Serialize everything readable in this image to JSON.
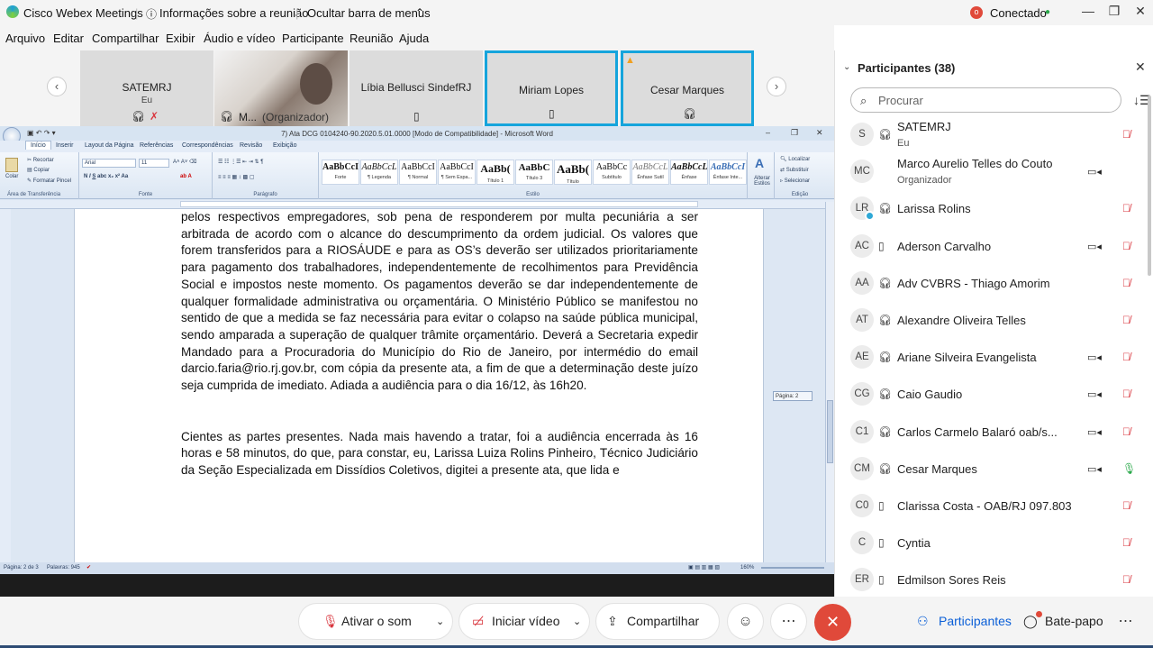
{
  "topbar": {
    "app_title": "Cisco Webex Meetings",
    "meeting_info": "Informações sobre a reunião",
    "hide_menu": "Ocultar barra de menus",
    "status_badge": "o",
    "status": "Conectado"
  },
  "menu": [
    "Arquivo",
    "Editar",
    "Compartilhar",
    "Exibir",
    "Áudio e vídeo",
    "Participante",
    "Reunião",
    "Ajuda"
  ],
  "video_tiles": [
    {
      "name": "SATEMRJ",
      "sub": "Eu"
    },
    {
      "name": "M...",
      "sub": "(Organizador)"
    },
    {
      "name": "Líbia Bellusci SindefRJ"
    },
    {
      "name": "Miriam Lopes"
    },
    {
      "name": "Cesar Marques"
    }
  ],
  "word": {
    "title": "7) Ata DCG 0104240-90.2020.5.01.0000 [Modo de Compatibilidade] - Microsoft Word",
    "tabs": [
      "Início",
      "Inserir",
      "Layout da Página",
      "Referências",
      "Correspondências",
      "Revisão",
      "Exibição"
    ],
    "clipboard": {
      "recortar": "Recortar",
      "copiar": "Copiar",
      "colar": "Colar",
      "pincel": "Formatar Pincel",
      "label": "Área de Transferência"
    },
    "font": {
      "name": "Arial",
      "size": "11",
      "label": "Fonte"
    },
    "paragraph_label": "Parágrafo",
    "styles_label": "Estilo",
    "styles": [
      {
        "sample": "AaBbCcI",
        "name": "Forte"
      },
      {
        "sample": "AaBbCcL",
        "name": "¶ Legenda"
      },
      {
        "sample": "AaBbCcI",
        "name": "¶ Normal"
      },
      {
        "sample": "AaBbCcI",
        "name": "¶ Sem Espa..."
      },
      {
        "sample": "AaBb(",
        "name": "Título 1"
      },
      {
        "sample": "AaBbC",
        "name": "Título 3"
      },
      {
        "sample": "AaBb(",
        "name": "Título"
      },
      {
        "sample": "AaBbCc",
        "name": "Subtítulo"
      },
      {
        "sample": "AaBbCcL",
        "name": "Ênfase Sutil"
      },
      {
        "sample": "AaBbCcL",
        "name": "Ênfase"
      },
      {
        "sample": "AaBbCcI",
        "name": "Ênfase Inte..."
      }
    ],
    "alterar_estilos": "Alterar Estilos",
    "editing": {
      "localizar": "Localizar",
      "substituir": "Substituir",
      "selecionar": "Selecionar",
      "label": "Edição"
    },
    "page_tooltip": "Página: 2",
    "paragraph1": "pelos respectivos empregadores, sob pena de responderem por multa pecuniária a ser arbitrada de acordo com o alcance do descumprimento da ordem judicial. Os valores que forem transferidos para a RIOSÁUDE e para as OS’s deverão ser utilizados prioritariamente para pagamento dos trabalhadores, independentemente de recolhimentos para Previdência Social e impostos neste momento. Os pagamentos deverão se dar independentemente de qualquer formalidade administrativa ou orçamentária. O Ministério Público se manifestou no sentido de que a medida se faz necessária para evitar o colapso na saúde pública municipal, sendo amparada a superação de qualquer trâmite orçamentário. Deverá a Secretaria expedir Mandado para a Procuradoria do Município do Rio de Janeiro, por intermédio do email darcio.faria@rio.rj.gov.br, com cópia da presente ata, a fim de que a determinação deste juízo seja cumprida de imediato. Adiada a audiência para o dia 16/12, às 16h20.",
    "paragraph2": "Cientes as partes presentes. Nada mais havendo a tratar, foi a audiência encerrada às 16 horas e 58 minutos, do que, para constar, eu, Larissa Luiza Rolins Pinheiro, Técnico Judiciário da Seção Especializada em Dissídios Coletivos, digitei a presente ata, que lida e",
    "status_page": "Página: 2 de 3",
    "status_words": "Palavras: 945",
    "zoom": "160%"
  },
  "participants": {
    "header": "Participantes (38)",
    "search_placeholder": "Procurar",
    "list": [
      {
        "initials": "S",
        "name": "SATEMRJ",
        "role": "Eu",
        "device": "headset",
        "video": false,
        "mic": "muted"
      },
      {
        "initials": "MC",
        "name": "Marco Aurelio Telles do Couto",
        "role": "Organizador",
        "device": "none",
        "video": true,
        "mic": "none"
      },
      {
        "initials": "LR",
        "name": "Larissa Rolins",
        "role": "",
        "device": "headset",
        "video": false,
        "mic": "muted"
      },
      {
        "initials": "AC",
        "name": "Aderson Carvalho",
        "role": "",
        "device": "phone",
        "video": true,
        "mic": "muted"
      },
      {
        "initials": "AA",
        "name": "Adv CVBRS - Thiago Amorim",
        "role": "",
        "device": "headset",
        "video": false,
        "mic": "muted"
      },
      {
        "initials": "AT",
        "name": "Alexandre Oliveira Telles",
        "role": "",
        "device": "headset",
        "video": false,
        "mic": "muted"
      },
      {
        "initials": "AE",
        "name": "Ariane Silveira Evangelista",
        "role": "",
        "device": "headset",
        "video": true,
        "mic": "muted"
      },
      {
        "initials": "CG",
        "name": "Caio Gaudio",
        "role": "",
        "device": "headset",
        "video": true,
        "mic": "muted"
      },
      {
        "initials": "C1",
        "name": "Carlos Carmelo Balaró oab/s...",
        "role": "",
        "device": "headset",
        "video": true,
        "mic": "muted"
      },
      {
        "initials": "CM",
        "name": "Cesar Marques",
        "role": "",
        "device": "headset",
        "video": true,
        "mic": "active"
      },
      {
        "initials": "C0",
        "name": "Clarissa Costa - OAB/RJ 097.803",
        "role": "",
        "device": "phone",
        "video": false,
        "mic": "muted"
      },
      {
        "initials": "C",
        "name": "Cyntia",
        "role": "",
        "device": "phone",
        "video": false,
        "mic": "muted"
      },
      {
        "initials": "ER",
        "name": "Edmilson Sores Reis",
        "role": "",
        "device": "phone",
        "video": false,
        "mic": "muted"
      }
    ]
  },
  "controls": {
    "audio": "Ativar o som",
    "video": "Iniciar vídeo",
    "share": "Compartilhar",
    "participants": "Participantes",
    "chat": "Bate-papo"
  },
  "colors": {
    "accent": "#15a4dc",
    "end_call": "#e0493a",
    "muted": "#d9363e",
    "link_blue": "#0b5fd7"
  }
}
